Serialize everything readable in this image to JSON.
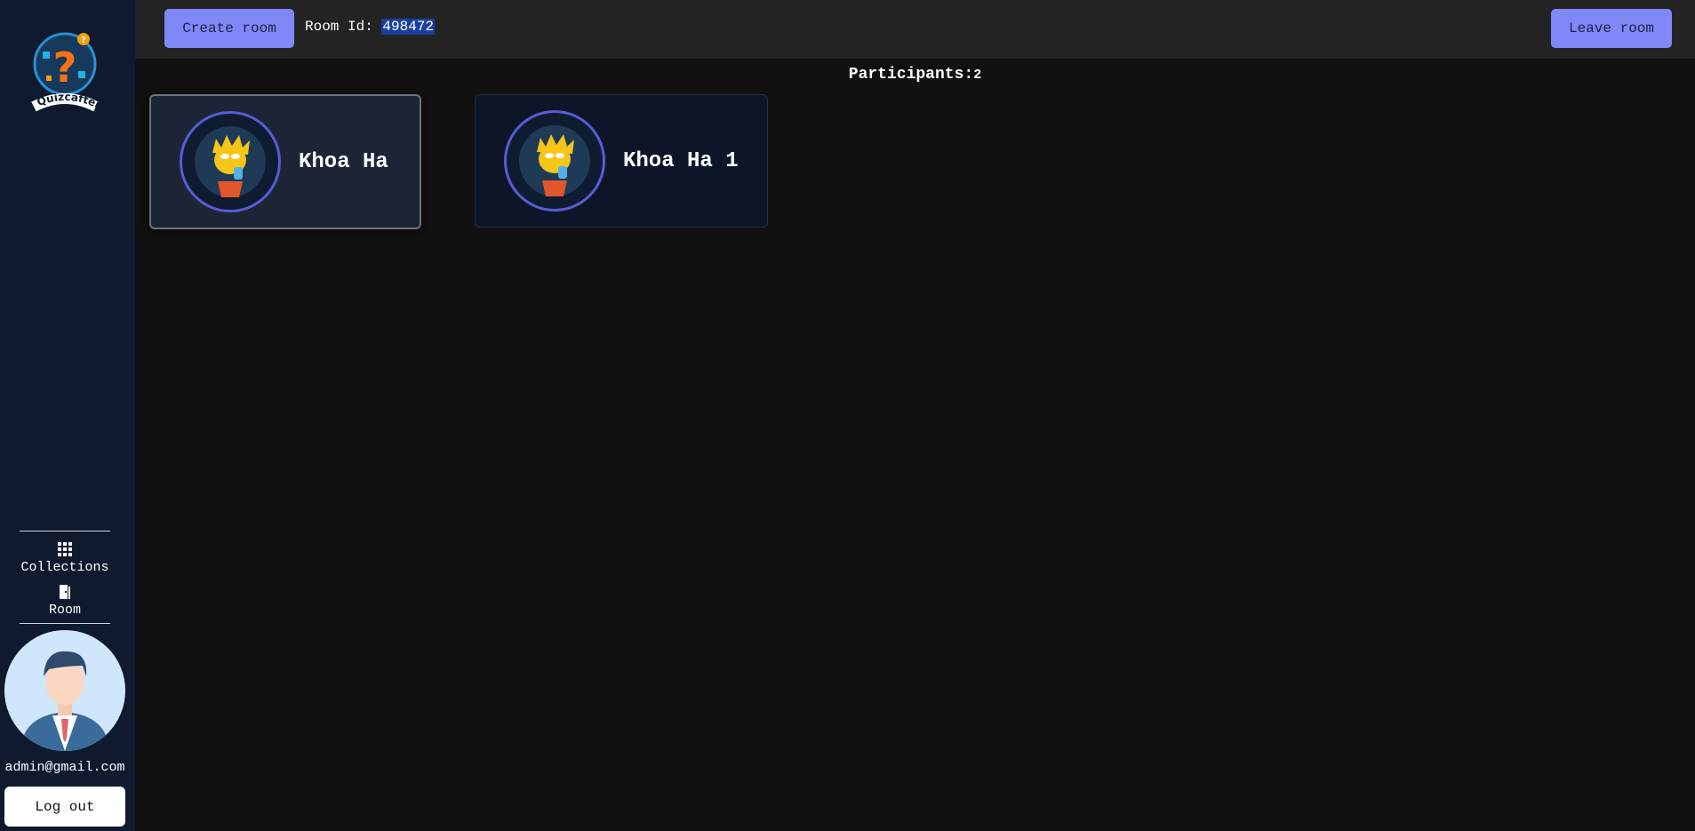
{
  "sidebar": {
    "logo_text": "Quizcafters",
    "nav": [
      {
        "label": "Collections",
        "icon": "grid-icon"
      },
      {
        "label": "Room",
        "icon": "door-icon"
      }
    ],
    "user_email": "admin@gmail.com",
    "logout_label": "Log out"
  },
  "topbar": {
    "create_room_label": "Create room",
    "room_id_label": "Room Id:",
    "room_id_value": "498472",
    "leave_room_label": "Leave room"
  },
  "main": {
    "participants_label": "Participants:",
    "participants_count": "2",
    "participants": [
      {
        "name": "Khoa Ha"
      },
      {
        "name": "Khoa Ha 1"
      }
    ]
  },
  "colors": {
    "sidebar_bg": "#0f1a2e",
    "accent": "#8088f7",
    "page_bg": "#111111"
  }
}
